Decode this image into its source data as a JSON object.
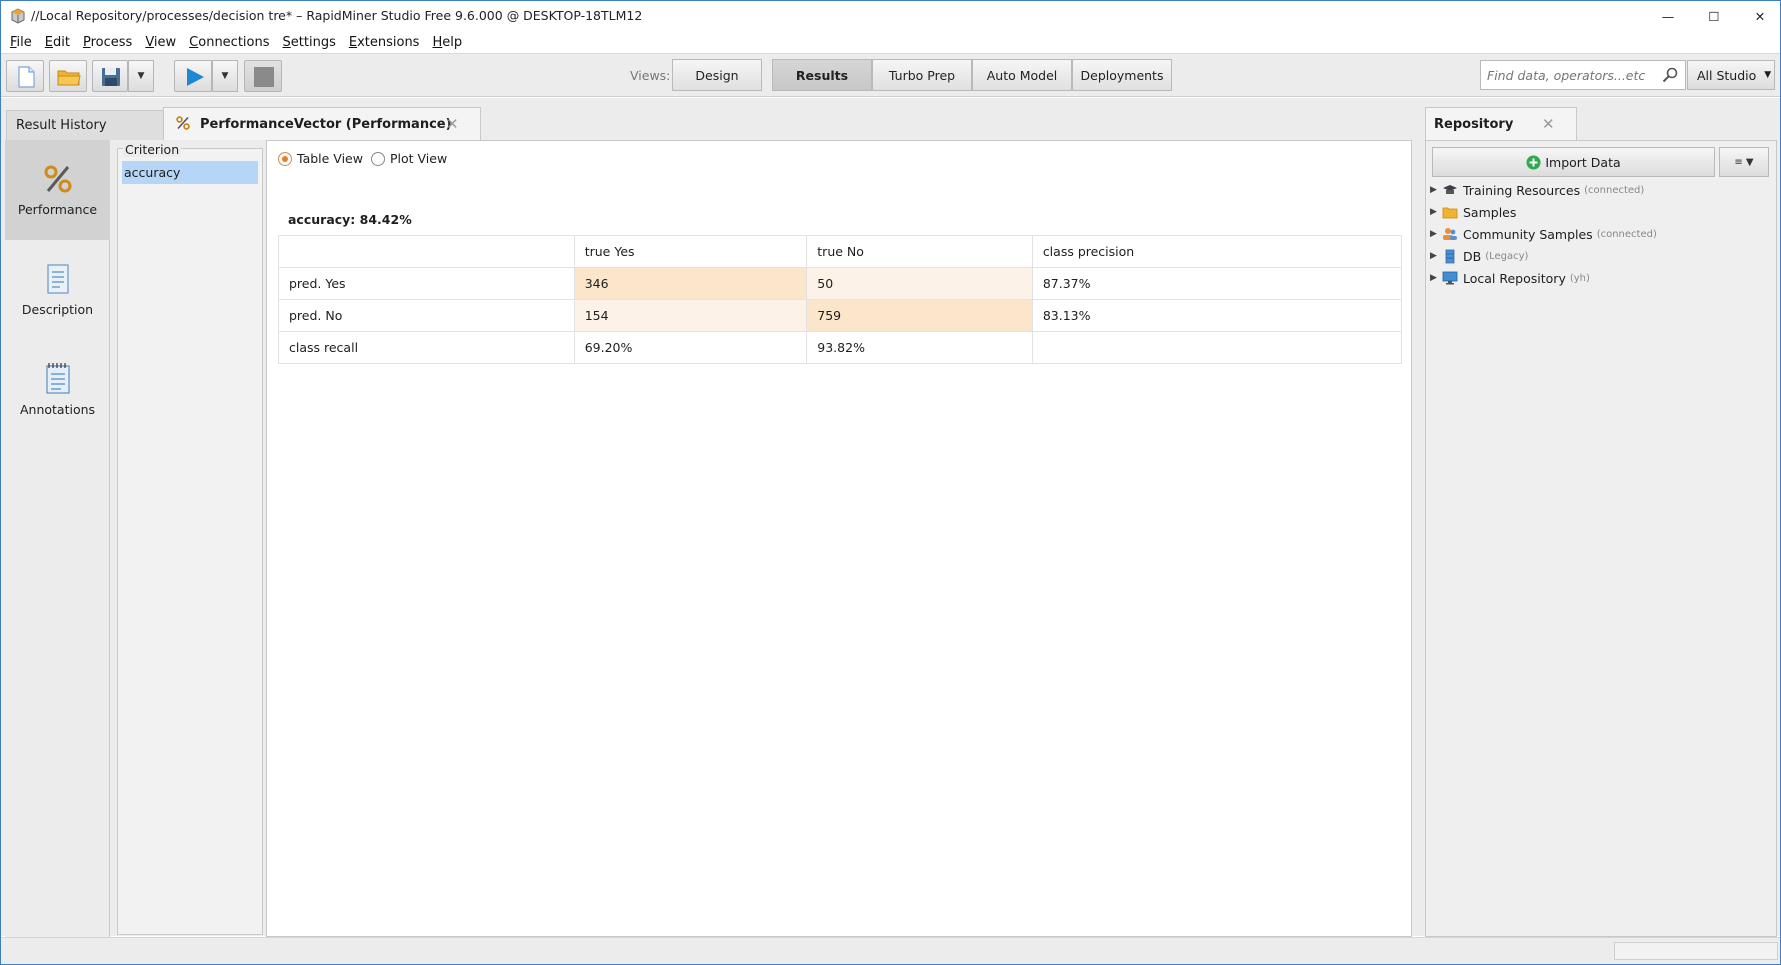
{
  "window": {
    "title": "//Local Repository/processes/decision tre* – RapidMiner Studio Free 9.6.000 @ DESKTOP-18TLM12",
    "minimize_glyph": "—",
    "maximize_glyph": "☐",
    "close_glyph": "✕"
  },
  "menu": [
    {
      "mn": "F",
      "rest": "ile"
    },
    {
      "mn": "E",
      "rest": "dit"
    },
    {
      "mn": "P",
      "rest": "rocess"
    },
    {
      "mn": "V",
      "rest": "iew"
    },
    {
      "mn": "C",
      "rest": "onnections"
    },
    {
      "mn": "S",
      "rest": "ettings"
    },
    {
      "mn": "E",
      "rest": "xtensions"
    },
    {
      "mn": "H",
      "rest": "elp"
    }
  ],
  "toolbar": {
    "views_label": "Views:",
    "views": [
      "Design",
      "Results",
      "Turbo Prep",
      "Auto Model",
      "Deployments"
    ],
    "active_view": "Results",
    "search_placeholder": "Find data, operators...etc",
    "scope": "All Studio",
    "icons": [
      "new-process-icon",
      "open-folder-icon",
      "save-icon",
      "run-icon",
      "stop-icon"
    ],
    "accent_run": "#1e88d3",
    "accent_folder": "#f2b233"
  },
  "tabs": {
    "result_history": "Result History",
    "performance": "PerformanceVector (Performance)",
    "close_glyph": "✕"
  },
  "sidenav": [
    {
      "label": "Performance",
      "icon": "percent-icon",
      "active": true
    },
    {
      "label": "Description",
      "icon": "document-icon",
      "active": false
    },
    {
      "label": "Annotations",
      "icon": "notepad-icon",
      "active": false
    }
  ],
  "criterion": {
    "title": "Criterion",
    "items": [
      "accuracy"
    ]
  },
  "view_mode": {
    "table": "Table View",
    "plot": "Plot View",
    "selected": "Table View"
  },
  "performance": {
    "accuracy_label": "accuracy: 84.42%",
    "header": [
      "",
      "true Yes",
      "true No",
      "class precision"
    ],
    "rows": [
      [
        "pred. Yes",
        "346",
        "50",
        "87.37%"
      ],
      [
        "pred. No",
        "154",
        "759",
        "83.13%"
      ],
      [
        "class recall",
        "69.20%",
        "93.82%",
        ""
      ]
    ],
    "highlight_color": "#fbe6cc",
    "light_color": "#fcf2e7"
  },
  "repository": {
    "title": "Repository",
    "import_label": "Import Data",
    "menu_glyph": "≡ ▼",
    "items": [
      {
        "label": "Training Resources",
        "tag": "(connected)",
        "icon": "graduation-cap-icon"
      },
      {
        "label": "Samples",
        "tag": "",
        "icon": "folder-icon"
      },
      {
        "label": "Community Samples",
        "tag": "(connected)",
        "icon": "people-icon"
      },
      {
        "label": "DB",
        "tag": "(Legacy)",
        "icon": "database-icon"
      },
      {
        "label": "Local Repository",
        "tag": "(yh)",
        "icon": "monitor-icon"
      }
    ]
  }
}
